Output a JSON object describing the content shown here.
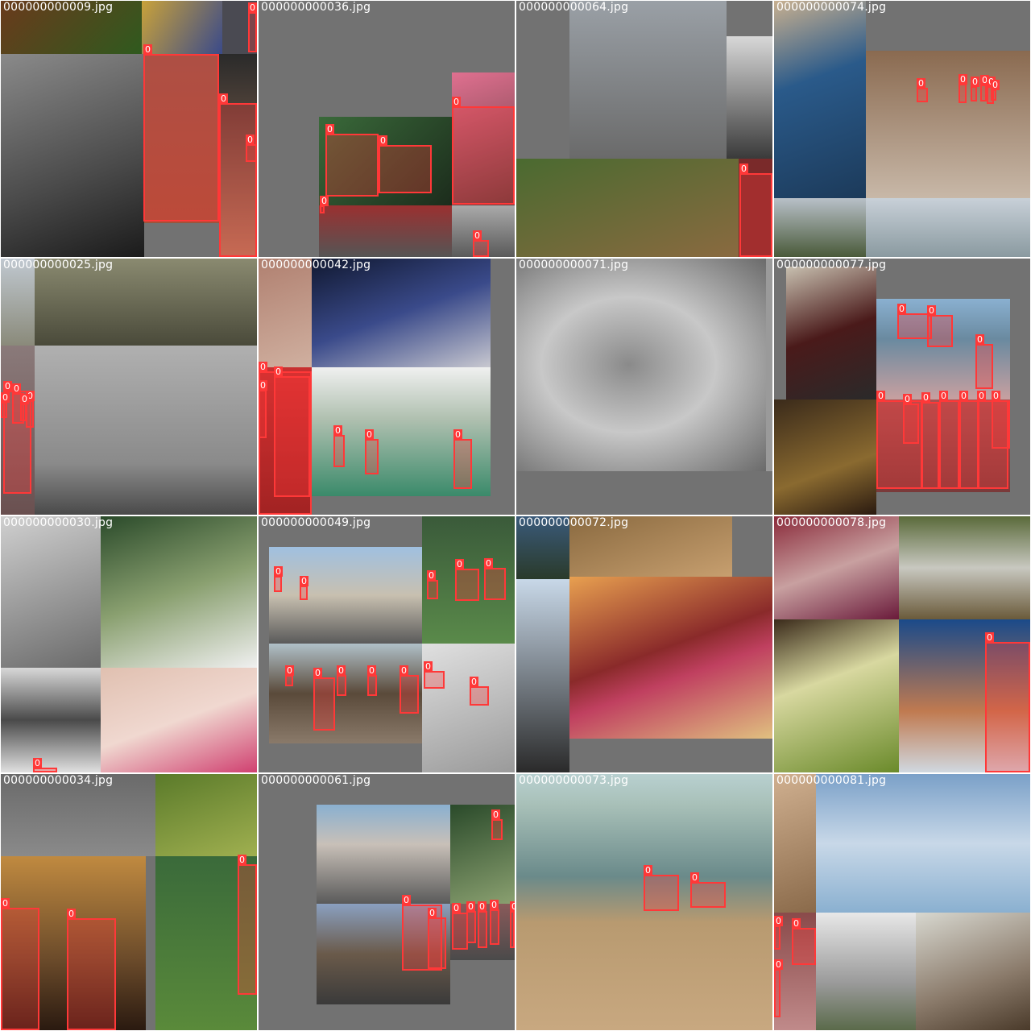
{
  "grid": {
    "tiles": [
      {
        "filename": "000000000009.jpg",
        "labels": [
          "0",
          "0",
          "0",
          "0"
        ]
      },
      {
        "filename": "000000000036.jpg",
        "labels": [
          "0",
          "0",
          "0",
          "0",
          "0"
        ]
      },
      {
        "filename": "000000000064.jpg",
        "labels": [
          "0"
        ]
      },
      {
        "filename": "000000000074.jpg",
        "labels": [
          "0",
          "0",
          "0",
          "0",
          "0",
          "0"
        ]
      },
      {
        "filename": "000000000025.jpg",
        "labels": [
          "0",
          "0",
          "0",
          "0",
          "0"
        ]
      },
      {
        "filename": "000000000042.jpg",
        "labels": [
          "0",
          "0",
          "0",
          "0",
          "0",
          "0"
        ]
      },
      {
        "filename": "000000000071.jpg",
        "labels": []
      },
      {
        "filename": "000000000077.jpg",
        "labels": [
          "0",
          "0",
          "0",
          "0",
          "0",
          "0",
          "0",
          "0",
          "0",
          "0"
        ]
      },
      {
        "filename": "000000000030.jpg",
        "labels": [
          "0"
        ]
      },
      {
        "filename": "000000000049.jpg",
        "labels": [
          "0",
          "0",
          "0",
          "0",
          "0",
          "0",
          "0",
          "0",
          "0",
          "0",
          "0",
          "0"
        ]
      },
      {
        "filename": "000000000072.jpg",
        "labels": []
      },
      {
        "filename": "000000000078.jpg",
        "labels": [
          "0"
        ]
      },
      {
        "filename": "000000000034.jpg",
        "labels": [
          "0",
          "0",
          "0"
        ]
      },
      {
        "filename": "000000000061.jpg",
        "labels": [
          "0",
          "0",
          "0",
          "0",
          "0",
          "0",
          "0",
          "0"
        ]
      },
      {
        "filename": "000000000073.jpg",
        "labels": [
          "0",
          "0"
        ]
      },
      {
        "filename": "000000000081.jpg",
        "labels": [
          "0",
          "0",
          "0"
        ]
      }
    ]
  },
  "colors": {
    "tile_background": "#727272",
    "box": "#ff3838",
    "text": "#ffffff"
  }
}
